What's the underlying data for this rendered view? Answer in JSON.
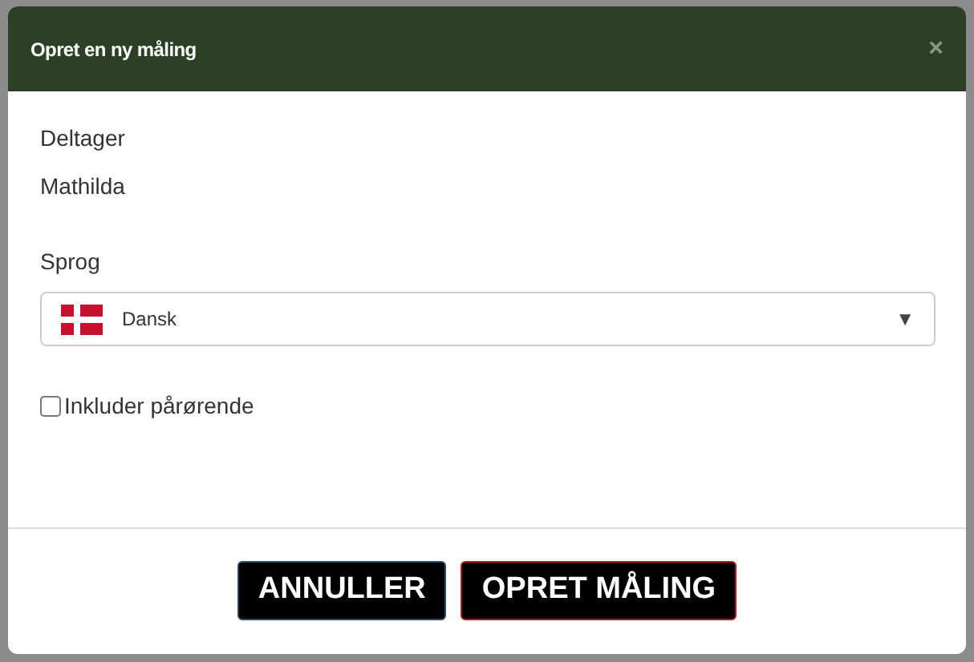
{
  "dialog": {
    "title": "Opret en ny måling",
    "close": "×"
  },
  "participant": {
    "label": "Deltager",
    "value": "Mathilda"
  },
  "language": {
    "label": "Sprog",
    "value": "Dansk",
    "arrow": "▼"
  },
  "include_relatives": {
    "label": "Inkluder pårørende",
    "checked": false
  },
  "buttons": [
    {
      "label": "ANNULLER",
      "kind": "cancel"
    },
    {
      "label": "OPRET MÅLING",
      "kind": "primary"
    }
  ]
}
